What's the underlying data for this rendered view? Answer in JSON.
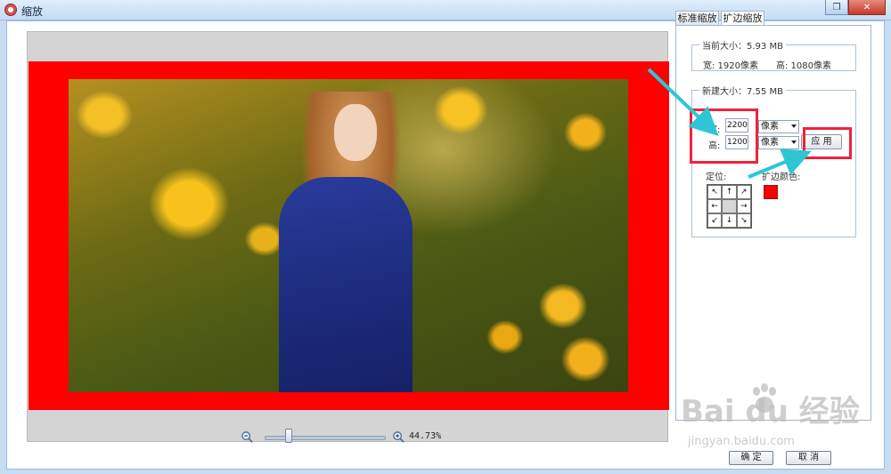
{
  "window": {
    "title": "缩放",
    "controls": [
      "restore",
      "close"
    ]
  },
  "tabs": [
    {
      "label": "标准缩放",
      "active": false
    },
    {
      "label": "扩边缩放",
      "active": true
    }
  ],
  "current_size": {
    "legend": "当前大小：5.93 MB",
    "width_text": "宽:  1920像素",
    "height_text": "高:  1080像素"
  },
  "new_size": {
    "legend": "新建大小：7.55 MB",
    "width_label": "宽:",
    "width_value": "2200",
    "height_label": "高:",
    "height_value": "1200",
    "unit_width": "像素",
    "unit_height": "像素",
    "apply_label": "应 用",
    "anchor_label": "定位:",
    "extend_color_label": "扩边颜色:",
    "extend_color": "#ff0000",
    "anchor_arrows": [
      "↖",
      "↑",
      "↗",
      "←",
      "",
      "→",
      "↙",
      "↓",
      "↘"
    ]
  },
  "zoom": {
    "level_text": "44.73%",
    "slider_fraction": 0.2
  },
  "buttons": {
    "ok": "确 定",
    "cancel": "取 消"
  },
  "watermark": {
    "main": "Bai  du 经验",
    "sub": "jingyan.baidu.com"
  },
  "colors": {
    "annotation": "#f0223b",
    "arrow": "#2ec6d4",
    "extend_fill": "#ff0000"
  }
}
